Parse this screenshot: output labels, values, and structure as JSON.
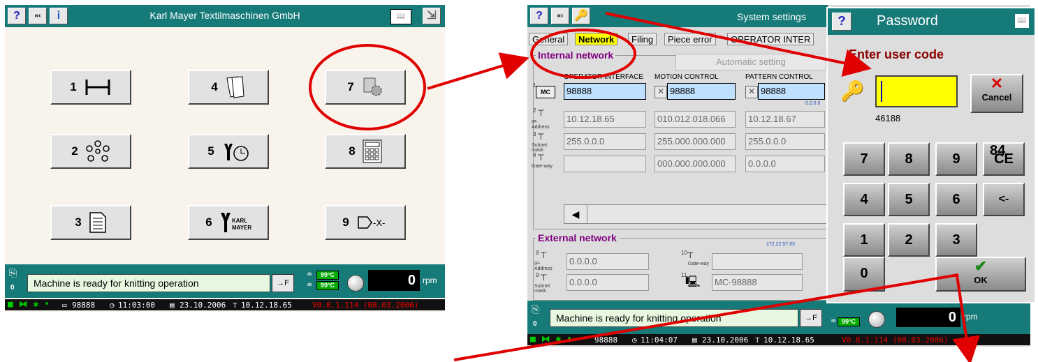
{
  "left_screen": {
    "title": "Karl Mayer Textilmaschinen GmbH",
    "buttons": [
      {
        "number": "1",
        "icon": "beam-icon"
      },
      {
        "number": "4",
        "icon": "documents-icon"
      },
      {
        "number": "7",
        "icon": "settings-gear-icon"
      },
      {
        "number": "2",
        "icon": "network-nodes-icon"
      },
      {
        "number": "5",
        "icon": "service-clock-icon"
      },
      {
        "number": "8",
        "icon": "calculator-icon"
      },
      {
        "number": "3",
        "icon": "document-icon"
      },
      {
        "number": "6",
        "icon": "karl-mayer-icon",
        "text": "KARL\nMAYER"
      },
      {
        "number": "9",
        "icon": "exit-icon",
        "text": "-X-"
      }
    ],
    "status_message": "Machine is ready for knitting operation",
    "counter": "0",
    "temp1": "99°C",
    "temp2": "99°C",
    "rpm_value": "0",
    "rpm_unit": "rpm",
    "machine_id": "98888",
    "time": "11:03:00",
    "date": "23.10.2006",
    "ip": "10.12.18.65",
    "version": "V0.8.1.114 (08.03.2006)",
    "f_button": "→F"
  },
  "right_screen": {
    "title": "System settings",
    "tabs": [
      "General",
      "Network",
      "Filing",
      "Piece error",
      "OPERATOR INTER"
    ],
    "tab_prefixes": [
      "0",
      "1",
      "2",
      "3"
    ],
    "internal_network": {
      "title": "Internal network",
      "automatic_setting": "Automatic setting",
      "col_headers": [
        "OPERATOR INTERFACE",
        "MOTION CONTROL",
        "PATTERN CONTROL"
      ],
      "row_labels": [
        "",
        "IP-Address",
        "Subnet mask",
        "Gate-way"
      ],
      "row_numbers": [
        "1",
        "2",
        "3",
        "4"
      ],
      "mc_label": "MC",
      "row1": [
        "98888",
        "98888",
        "98888"
      ],
      "row1_small": "0.0.0.0",
      "row2": [
        "10.12.18.65",
        "010.012.018.066",
        "10.12.18.67"
      ],
      "row3": [
        "255.0.0.0",
        "255.000.000.000",
        "255.0.0.0"
      ],
      "row4": [
        "",
        "000.000.000.000",
        "0.0.0.0"
      ],
      "scroll_left": "◀"
    },
    "external_network": {
      "title": "External network",
      "small_ip": "172.22.57.63",
      "row_numbers": [
        "8",
        "9",
        "10",
        "11"
      ],
      "ip_label": "IP-Address",
      "subnet_label": "Subnet mask",
      "gateway_label": "Gate-way",
      "ip": "0.0.0.0",
      "subnet": "0.0.0.0",
      "gateway": "",
      "mc_name": "MC-98888"
    },
    "status_message": "Machine is ready for knitting operation",
    "counter": "0",
    "temp1": "99°C",
    "temp2": "99°C",
    "rpm_value": "0",
    "rpm_unit": "rpm",
    "machine_id": "98888",
    "time": "11:04:07",
    "date": "23.10.2006",
    "ip": "10.12.18.65",
    "version": "V0.8.1.114 (08.03.2006)",
    "f_button": "→F"
  },
  "password_dialog": {
    "title": "Password",
    "prompt": "Enter user code",
    "code_hint": "46188",
    "cancel_label": "Cancel",
    "ok_label": "OK",
    "keys": [
      "7",
      "8",
      "9",
      "CE",
      "4",
      "5",
      "6",
      "<-",
      "1",
      "2",
      "3",
      "0"
    ],
    "ce_overlay": "84"
  },
  "colors": {
    "teal": "#157a78",
    "annotation_red": "#e00000",
    "input_yellow": "#ffff00"
  }
}
